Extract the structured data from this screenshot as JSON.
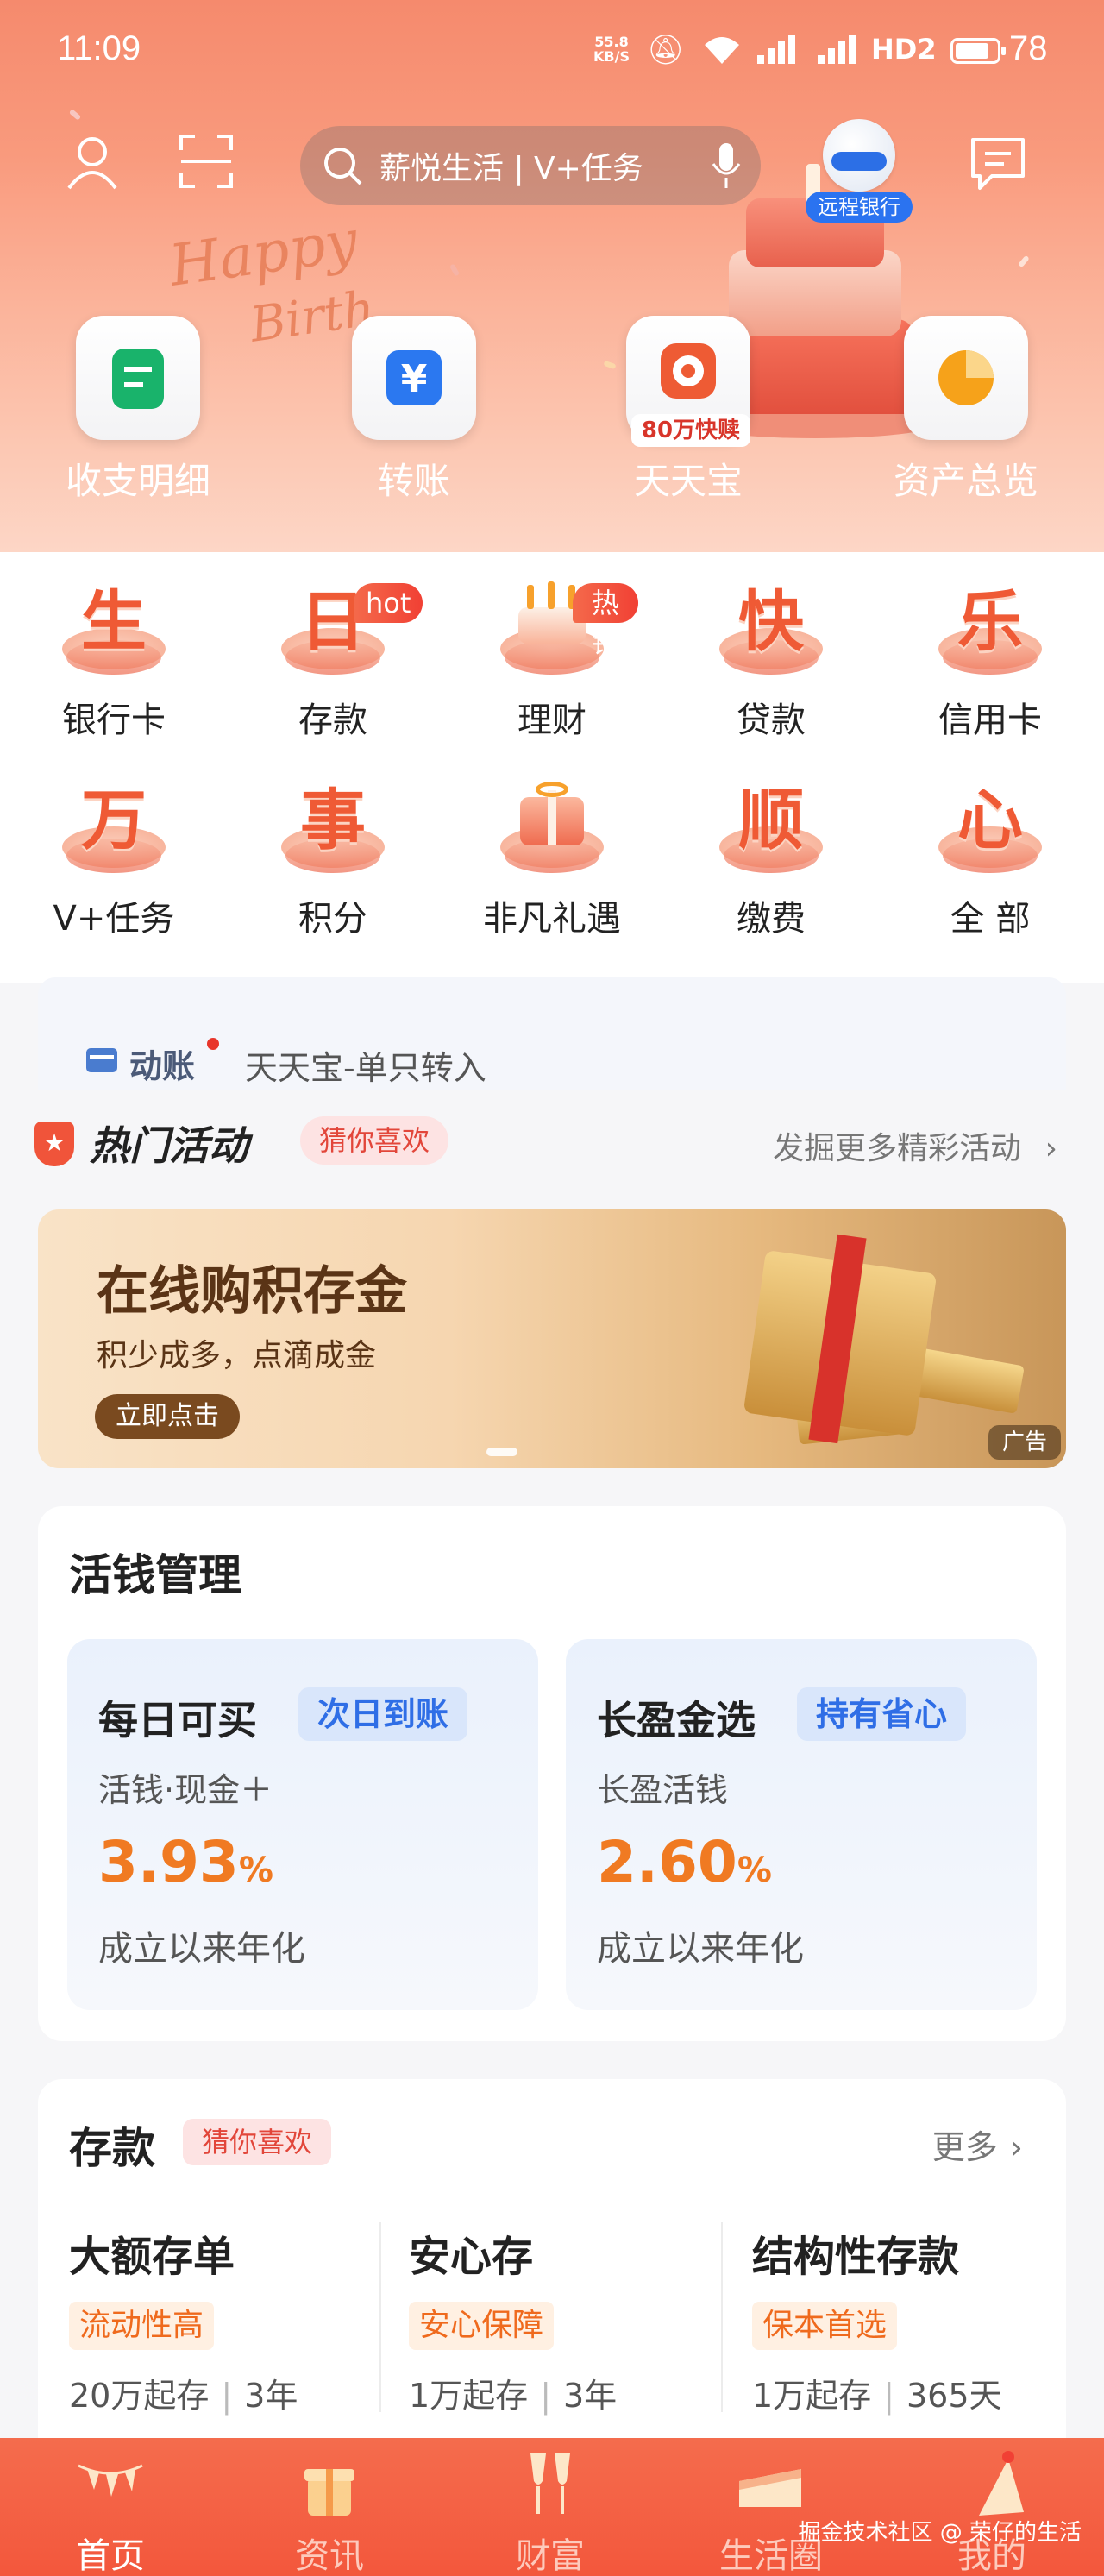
{
  "status": {
    "time": "11:09",
    "net_speed_top": "55.8",
    "net_speed_bottom": "KB/S",
    "signal_label": "HD2",
    "battery": "78"
  },
  "header": {
    "search_placeholder": "薪悦生活 | V+任务",
    "robot_label": "远程银行",
    "bg_text_1": "Happy",
    "bg_text_2": "Birth"
  },
  "quick_actions": [
    {
      "label": "收支明细",
      "icon": "ledger-icon"
    },
    {
      "label": "转账",
      "icon": "yuan-transfer-icon"
    },
    {
      "label": "天天宝",
      "icon": "cloud-wallet-icon",
      "badge": "80万快赎"
    },
    {
      "label": "资产总览",
      "icon": "pie-chart-icon"
    }
  ],
  "services": [
    {
      "char": "生",
      "label": "银行卡"
    },
    {
      "char": "日",
      "label": "存款",
      "tag": "hot"
    },
    {
      "char": "",
      "label": "理财",
      "tag": "热销"
    },
    {
      "char": "快",
      "label": "贷款"
    },
    {
      "char": "乐",
      "label": "信用卡"
    },
    {
      "char": "万",
      "label": "V+任务"
    },
    {
      "char": "事",
      "label": "积分"
    },
    {
      "char": "",
      "label": "非凡礼遇"
    },
    {
      "char": "顺",
      "label": "缴费"
    },
    {
      "char": "心",
      "label": "全 部"
    }
  ],
  "notice": {
    "keyword": "动账",
    "message": "天天宝-单只转入"
  },
  "activities": {
    "title": "热门活动",
    "tag": "猜你喜欢",
    "more": "发掘更多精彩活动",
    "banner": {
      "title": "在线购积存金",
      "subtitle": "积少成多，点滴成金",
      "button": "立即点击",
      "ad_label": "广告"
    }
  },
  "liquid": {
    "title": "活钱管理",
    "products": [
      {
        "name": "每日可买",
        "pill": "次日到账",
        "sub": "活钱·现金＋",
        "rate": "3.93",
        "unit": "%",
        "desc": "成立以来年化"
      },
      {
        "name": "长盈金选",
        "pill": "持有省心",
        "sub": "长盈活钱",
        "rate": "2.60",
        "unit": "%",
        "desc": "成立以来年化"
      }
    ]
  },
  "deposit": {
    "title": "存款",
    "tag": "猜你喜欢",
    "more": "更多",
    "items": [
      {
        "name": "大额存单",
        "tag": "流动性高",
        "min": "20万起存",
        "term": "3年"
      },
      {
        "name": "安心存",
        "tag": "安心保障",
        "min": "1万起存",
        "term": "3年"
      },
      {
        "name": "结构性存款",
        "tag": "保本首选",
        "min": "1万起存",
        "term": "365天"
      }
    ]
  },
  "tabbar": {
    "tabs": [
      {
        "label": "首页",
        "active": true
      },
      {
        "label": "资讯"
      },
      {
        "label": "财富"
      },
      {
        "label": "生活圈"
      },
      {
        "label": "我的"
      }
    ],
    "watermark": "掘金技术社区 @ 荣仔的生活"
  },
  "colors": {
    "accent": "#f3573c",
    "orange": "#f07a22",
    "blue": "#2f6ee6"
  }
}
